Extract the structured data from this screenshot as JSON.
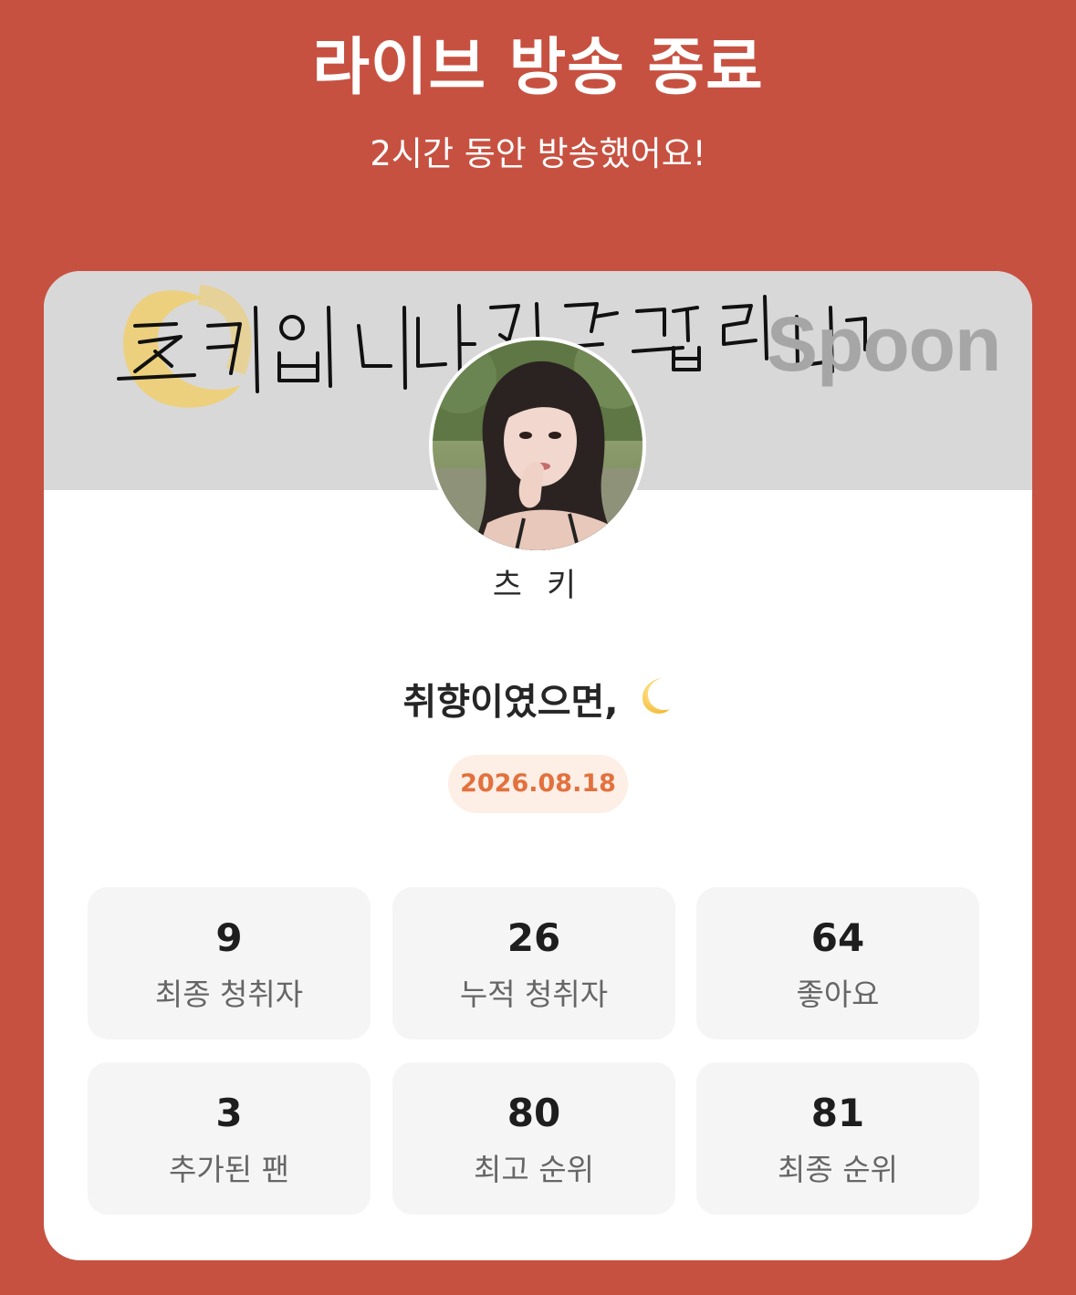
{
  "header": {
    "title": "라이브 방송 종료",
    "subtitle": "2시간 동안 방송했어요!"
  },
  "banner": {
    "handwriting_text": "츠키 입니다 잘 부탁 드립니다",
    "logo_text": "Spoon"
  },
  "profile": {
    "avatar_icon": "profile-photo",
    "nickname": "츠 키"
  },
  "live": {
    "title": "취향이였으면,",
    "title_emoji": "crescent-moon-icon",
    "date": "2026.08.18"
  },
  "stats": [
    {
      "value": "9",
      "label": "최종 청취자"
    },
    {
      "value": "26",
      "label": "누적 청취자"
    },
    {
      "value": "64",
      "label": "좋아요"
    },
    {
      "value": "3",
      "label": "추가된 팬"
    },
    {
      "value": "80",
      "label": "최고 순위"
    },
    {
      "value": "81",
      "label": "최종 순위"
    }
  ],
  "colors": {
    "background": "#c75141",
    "card": "#ffffff",
    "banner": "#d8d8d8",
    "date_badge_bg": "#fdeee6",
    "date_badge_text": "#e2713d",
    "stat_bg": "#f5f5f5"
  }
}
